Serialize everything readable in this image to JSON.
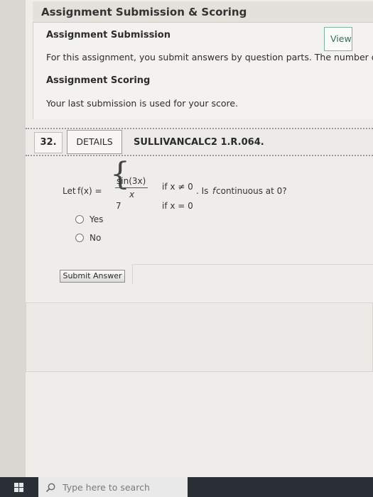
{
  "submission_panel": {
    "title": "Assignment Submission & Scoring",
    "submission_heading": "Assignment Submission",
    "submission_text": "For this assignment, you submit answers by question parts. The number o",
    "scoring_heading": "Assignment Scoring",
    "scoring_text": "Your last submission is used for your score."
  },
  "question": {
    "number": "32.",
    "details_label": "DETAILS",
    "code": "SULLIVANCALC2 1.R.064.",
    "let_text": "Let ",
    "fx_label": "f(x) =",
    "numerator": "sin(3x)",
    "denominator": "x",
    "case_value": "7",
    "condition1": "if x ≠ 0",
    "condition2": "if x = 0",
    "prompt_pre": ". Is ",
    "prompt_f": "f",
    "prompt_post": " continuous at 0?",
    "options": [
      {
        "label": "Yes",
        "selected": false
      },
      {
        "label": "No",
        "selected": false
      }
    ],
    "submit_label": "Submit Answer"
  },
  "lower_panel": {
    "view_label": "View"
  },
  "taskbar": {
    "start_icon": "windows-icon",
    "search_icon": "search-icon",
    "search_placeholder": "Type here to search"
  }
}
